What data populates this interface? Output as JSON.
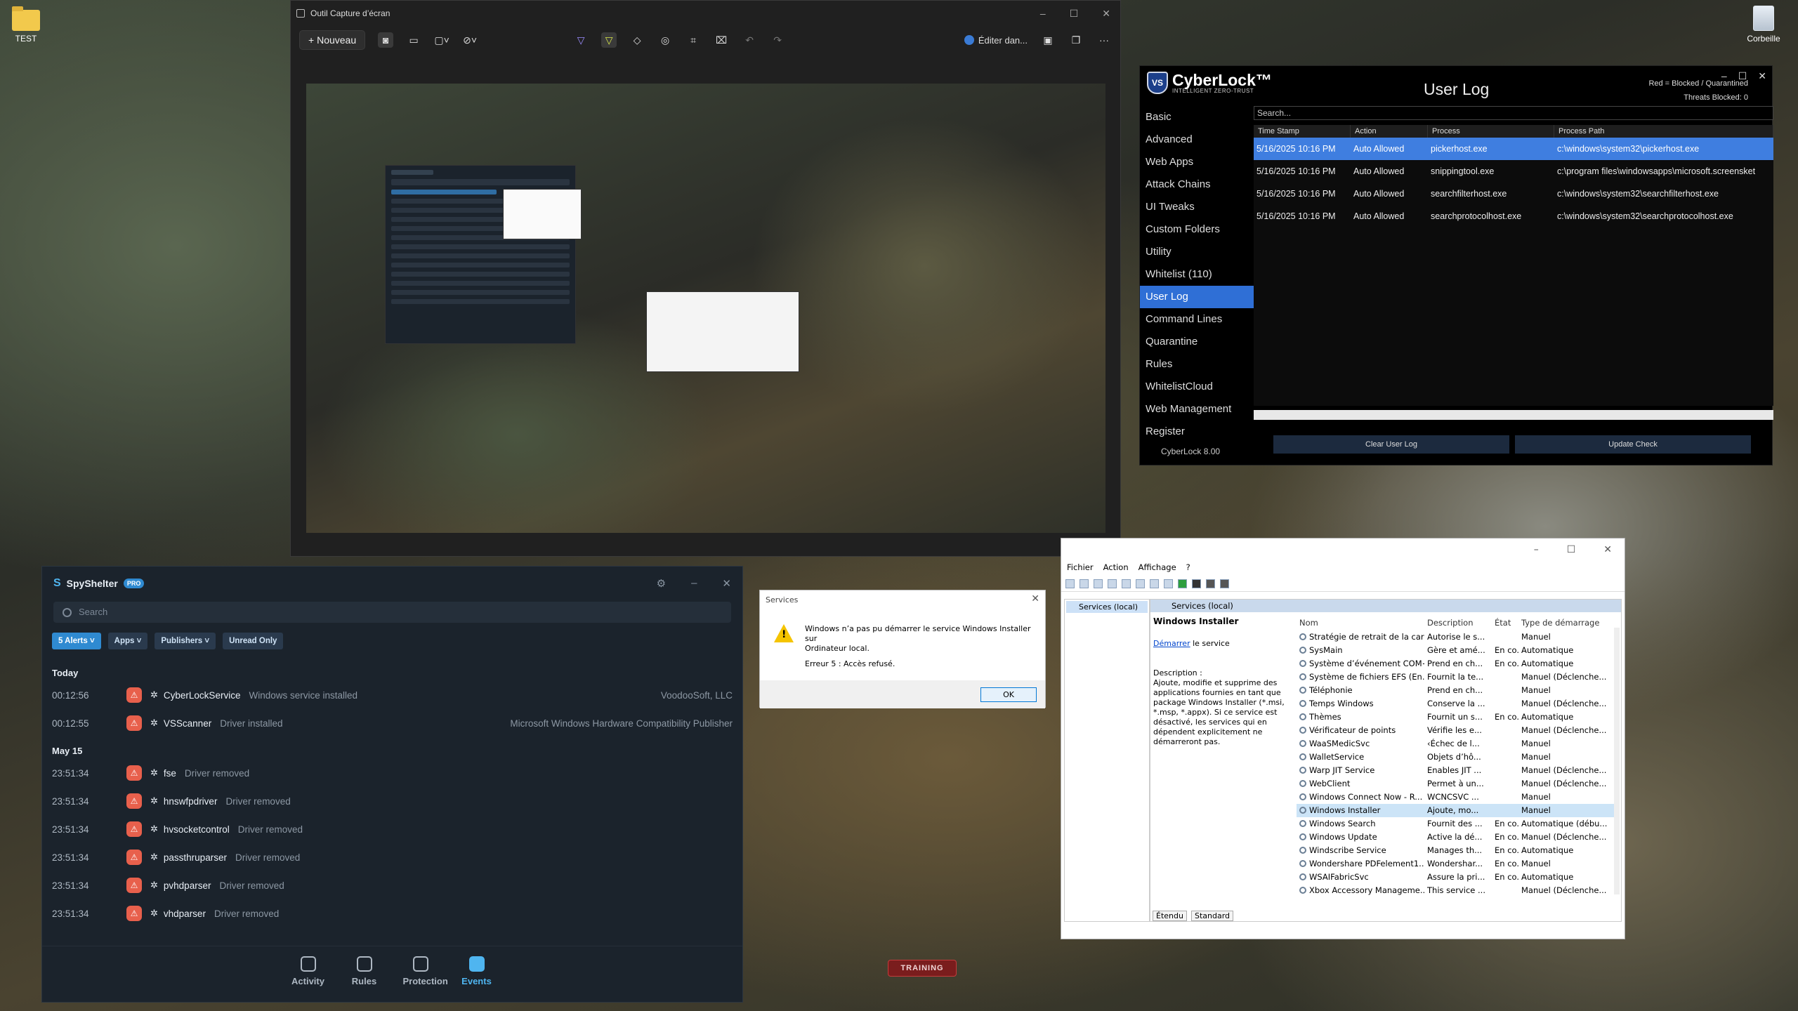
{
  "desktop": {
    "icons": [
      {
        "label": "TEST"
      },
      {
        "label": "Corbeille"
      }
    ]
  },
  "snipping_tool": {
    "title": "Outil Capture d’écran",
    "new_label": "Nouveau",
    "edit_label": "Éditer dan...",
    "more_label": "···"
  },
  "cyberlock": {
    "brand": "CyberLock™",
    "brand_sub": "INTELLIGENT ZERO-TRUST",
    "badge": "VS",
    "title": "User Log",
    "legend_line1": "Red = Blocked / Quarantined",
    "legend_line2": "Threats Blocked: 0",
    "search_placeholder": "Search...",
    "nav": [
      "Basic",
      "Advanced",
      "Web Apps",
      "Attack Chains",
      "UI Tweaks",
      "Custom Folders",
      "Utility",
      "Whitelist (110)",
      "User Log",
      "Command Lines",
      "Quarantine",
      "Rules",
      "WhitelistCloud",
      "Web Management",
      "Register"
    ],
    "active_nav": "User Log",
    "version": "CyberLock 8.00",
    "columns": [
      "Time Stamp",
      "Action",
      "Process",
      "Process Path"
    ],
    "rows": [
      {
        "time": "5/16/2025 10:16 PM",
        "action": "Auto Allowed",
        "process": "pickerhost.exe",
        "path": "c:\\windows\\system32\\pickerhost.exe"
      },
      {
        "time": "5/16/2025 10:16 PM",
        "action": "Auto Allowed",
        "process": "snippingtool.exe",
        "path": "c:\\program files\\windowsapps\\microsoft.screensket"
      },
      {
        "time": "5/16/2025 10:16 PM",
        "action": "Auto Allowed",
        "process": "searchfilterhost.exe",
        "path": "c:\\windows\\system32\\searchfilterhost.exe"
      },
      {
        "time": "5/16/2025 10:16 PM",
        "action": "Auto Allowed",
        "process": "searchprotocolhost.exe",
        "path": "c:\\windows\\system32\\searchprotocolhost.exe"
      }
    ],
    "clear_label": "Clear User Log",
    "update_label": "Update Check"
  },
  "spyshelter": {
    "logo": "S",
    "name": "SpyShelter",
    "badge": "PRO",
    "search_placeholder": "Search",
    "filters": [
      "5 Alerts ˅",
      "Apps ˅",
      "Publishers ˅",
      "Unread Only"
    ],
    "sections": [
      {
        "label": "Today",
        "events": [
          {
            "time": "00:12:56",
            "name": "CyberLockService",
            "desc": "Windows service installed",
            "publisher": "VoodooSoft, LLC"
          },
          {
            "time": "00:12:55",
            "name": "VSScanner",
            "desc": "Driver installed",
            "publisher": "Microsoft Windows Hardware Compatibility Publisher"
          }
        ]
      },
      {
        "label": "May 15",
        "events": [
          {
            "time": "23:51:34",
            "name": "fse",
            "desc": "Driver removed",
            "publisher": ""
          },
          {
            "time": "23:51:34",
            "name": "hnswfpdriver",
            "desc": "Driver removed",
            "publisher": ""
          },
          {
            "time": "23:51:34",
            "name": "hvsocketcontrol",
            "desc": "Driver removed",
            "publisher": ""
          },
          {
            "time": "23:51:34",
            "name": "passthruparser",
            "desc": "Driver removed",
            "publisher": ""
          },
          {
            "time": "23:51:34",
            "name": "pvhdparser",
            "desc": "Driver removed",
            "publisher": ""
          },
          {
            "time": "23:51:34",
            "name": "vhdparser",
            "desc": "Driver removed",
            "publisher": ""
          }
        ]
      }
    ],
    "bottom_nav": [
      "Activity",
      "Rules",
      "Protection",
      "Events"
    ],
    "active_bottom": "Events"
  },
  "services_dialog": {
    "title": "Services",
    "message_line1": "Windows n’a pas pu démarrer le service Windows Installer sur",
    "message_line2": "Ordinateur local.",
    "error": "Erreur 5 : Accès refusé.",
    "ok_label": "OK"
  },
  "services": {
    "menu": [
      "Fichier",
      "Action",
      "Affichage",
      "?"
    ],
    "tree_item": "Services (local)",
    "pane_title": "Services (local)",
    "selected_title": "Windows Installer",
    "start_link": "Démarrer",
    "start_rest": " le service",
    "description_label": "Description :",
    "description": "Ajoute, modifie et supprime des applications fournies en tant que package Windows Installer (*.msi, *.msp, *.appx). Si ce service est désactivé, les services qui en dépendent explicitement ne démarreront pas.",
    "columns": [
      "Nom",
      "Description",
      "État",
      "Type de démarrage"
    ],
    "rows": [
      {
        "name": "Stratégie de retrait de la cart...",
        "desc": "Autorise le s...",
        "state": "",
        "type": "Manuel"
      },
      {
        "name": "SysMain",
        "desc": "Gère et amé...",
        "state": "En co...",
        "type": "Automatique"
      },
      {
        "name": "Système d’événement COM+",
        "desc": "Prend en ch...",
        "state": "En co...",
        "type": "Automatique"
      },
      {
        "name": "Système de fichiers EFS (En...",
        "desc": "Fournit la te...",
        "state": "",
        "type": "Manuel (Déclenche..."
      },
      {
        "name": "Téléphonie",
        "desc": "Prend en ch...",
        "state": "",
        "type": "Manuel"
      },
      {
        "name": "Temps Windows",
        "desc": "Conserve la ...",
        "state": "",
        "type": "Manuel (Déclenche..."
      },
      {
        "name": "Thèmes",
        "desc": "Fournit un s...",
        "state": "En co...",
        "type": "Automatique"
      },
      {
        "name": "Vérificateur de points",
        "desc": "Vérifie les e...",
        "state": "",
        "type": "Manuel (Déclenche..."
      },
      {
        "name": "WaaSMedicSvc",
        "desc": "‹Échec de l...",
        "state": "",
        "type": "Manuel"
      },
      {
        "name": "WalletService",
        "desc": "Objets d’hô...",
        "state": "",
        "type": "Manuel"
      },
      {
        "name": "Warp JIT Service",
        "desc": "Enables JIT ...",
        "state": "",
        "type": "Manuel (Déclenche..."
      },
      {
        "name": "WebClient",
        "desc": "Permet à un...",
        "state": "",
        "type": "Manuel (Déclenche..."
      },
      {
        "name": "Windows Connect Now - R...",
        "desc": "WCNCSVC ...",
        "state": "",
        "type": "Manuel"
      },
      {
        "name": "Windows Installer",
        "desc": "Ajoute, mo...",
        "state": "",
        "type": "Manuel"
      },
      {
        "name": "Windows Search",
        "desc": "Fournit des ...",
        "state": "En co...",
        "type": "Automatique (débu..."
      },
      {
        "name": "Windows Update",
        "desc": "Active la dé...",
        "state": "En co...",
        "type": "Manuel (Déclenche..."
      },
      {
        "name": "Windscribe Service",
        "desc": "Manages th...",
        "state": "En co...",
        "type": "Automatique"
      },
      {
        "name": "Wondershare PDFelement1...",
        "desc": "Wondershar...",
        "state": "En co...",
        "type": "Manuel"
      },
      {
        "name": "WSAIFabricSvc",
        "desc": "Assure la pri...",
        "state": "En co...",
        "type": "Automatique"
      },
      {
        "name": "Xbox Accessory Manageme...",
        "desc": "This service ...",
        "state": "",
        "type": "Manuel (Déclenche..."
      }
    ],
    "selected_row": "Windows Installer",
    "tabs": [
      "Étendu",
      "Standard"
    ]
  },
  "training_badge": "TRAINING"
}
